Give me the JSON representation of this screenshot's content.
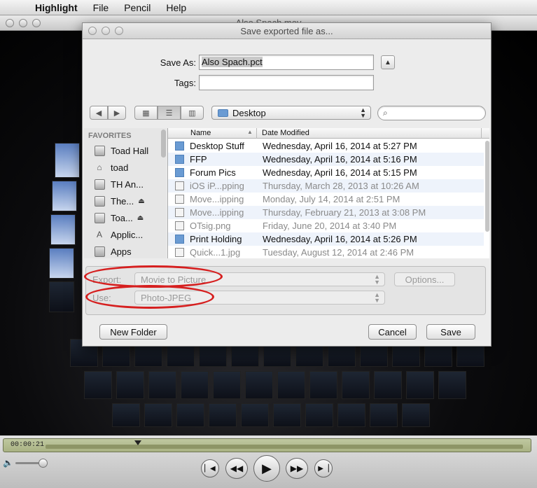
{
  "menubar": {
    "app_name": "Highlight",
    "items": [
      "File",
      "Pencil",
      "Help"
    ]
  },
  "movie": {
    "window_title": "Also Spach.mov",
    "current_time": "00:00:21"
  },
  "dialog": {
    "title": "Save exported file as...",
    "save_as_label": "Save As:",
    "save_as_value": "Also Spach.pct",
    "tags_label": "Tags:",
    "tags_value": "",
    "location": "Desktop",
    "sidebar": {
      "heading": "FAVORITES",
      "items": [
        {
          "label": "Toad Hall",
          "icon": "disk-icon"
        },
        {
          "label": "toad",
          "icon": "home-icon"
        },
        {
          "label": "TH An...",
          "icon": "disk-icon"
        },
        {
          "label": "The...",
          "icon": "disk-icon"
        },
        {
          "label": "Toa...",
          "icon": "disk-icon"
        },
        {
          "label": "Applic...",
          "icon": "applications-icon"
        },
        {
          "label": "Apps",
          "icon": "folder-icon"
        }
      ]
    },
    "columns": {
      "name": "Name",
      "date": "Date Modified"
    },
    "files": [
      {
        "name": "Desktop Stuff",
        "date": "Wednesday, April 16, 2014 at 5:27 PM",
        "kind": "folder",
        "dim": false
      },
      {
        "name": "FFP",
        "date": "Wednesday, April 16, 2014 at 5:16 PM",
        "kind": "folder",
        "dim": false
      },
      {
        "name": "Forum Pics",
        "date": "Wednesday, April 16, 2014 at 5:15 PM",
        "kind": "folder",
        "dim": false
      },
      {
        "name": "iOS iP...pping",
        "date": "Thursday, March 28, 2013 at 10:26 AM",
        "kind": "file",
        "dim": true
      },
      {
        "name": "Move...ipping",
        "date": "Monday, July 14, 2014 at 2:51 PM",
        "kind": "file",
        "dim": true
      },
      {
        "name": "Move...ipping",
        "date": "Thursday, February 21, 2013 at 3:08 PM",
        "kind": "file",
        "dim": true
      },
      {
        "name": "OTsig.png",
        "date": "Friday, June 20, 2014 at 3:40 PM",
        "kind": "file",
        "dim": true
      },
      {
        "name": "Print Holding",
        "date": "Wednesday, April 16, 2014 at 5:26 PM",
        "kind": "folder",
        "dim": false
      },
      {
        "name": "Quick...1.jpg",
        "date": "Tuesday, August 12, 2014 at 2:46 PM",
        "kind": "file",
        "dim": true
      }
    ],
    "export_label": "Export:",
    "export_value": "Movie to Picture",
    "options_label": "Options...",
    "use_label": "Use:",
    "use_value": "Photo-JPEG",
    "new_folder": "New Folder",
    "cancel": "Cancel",
    "save": "Save",
    "highlight_color": "#d61f1f"
  }
}
